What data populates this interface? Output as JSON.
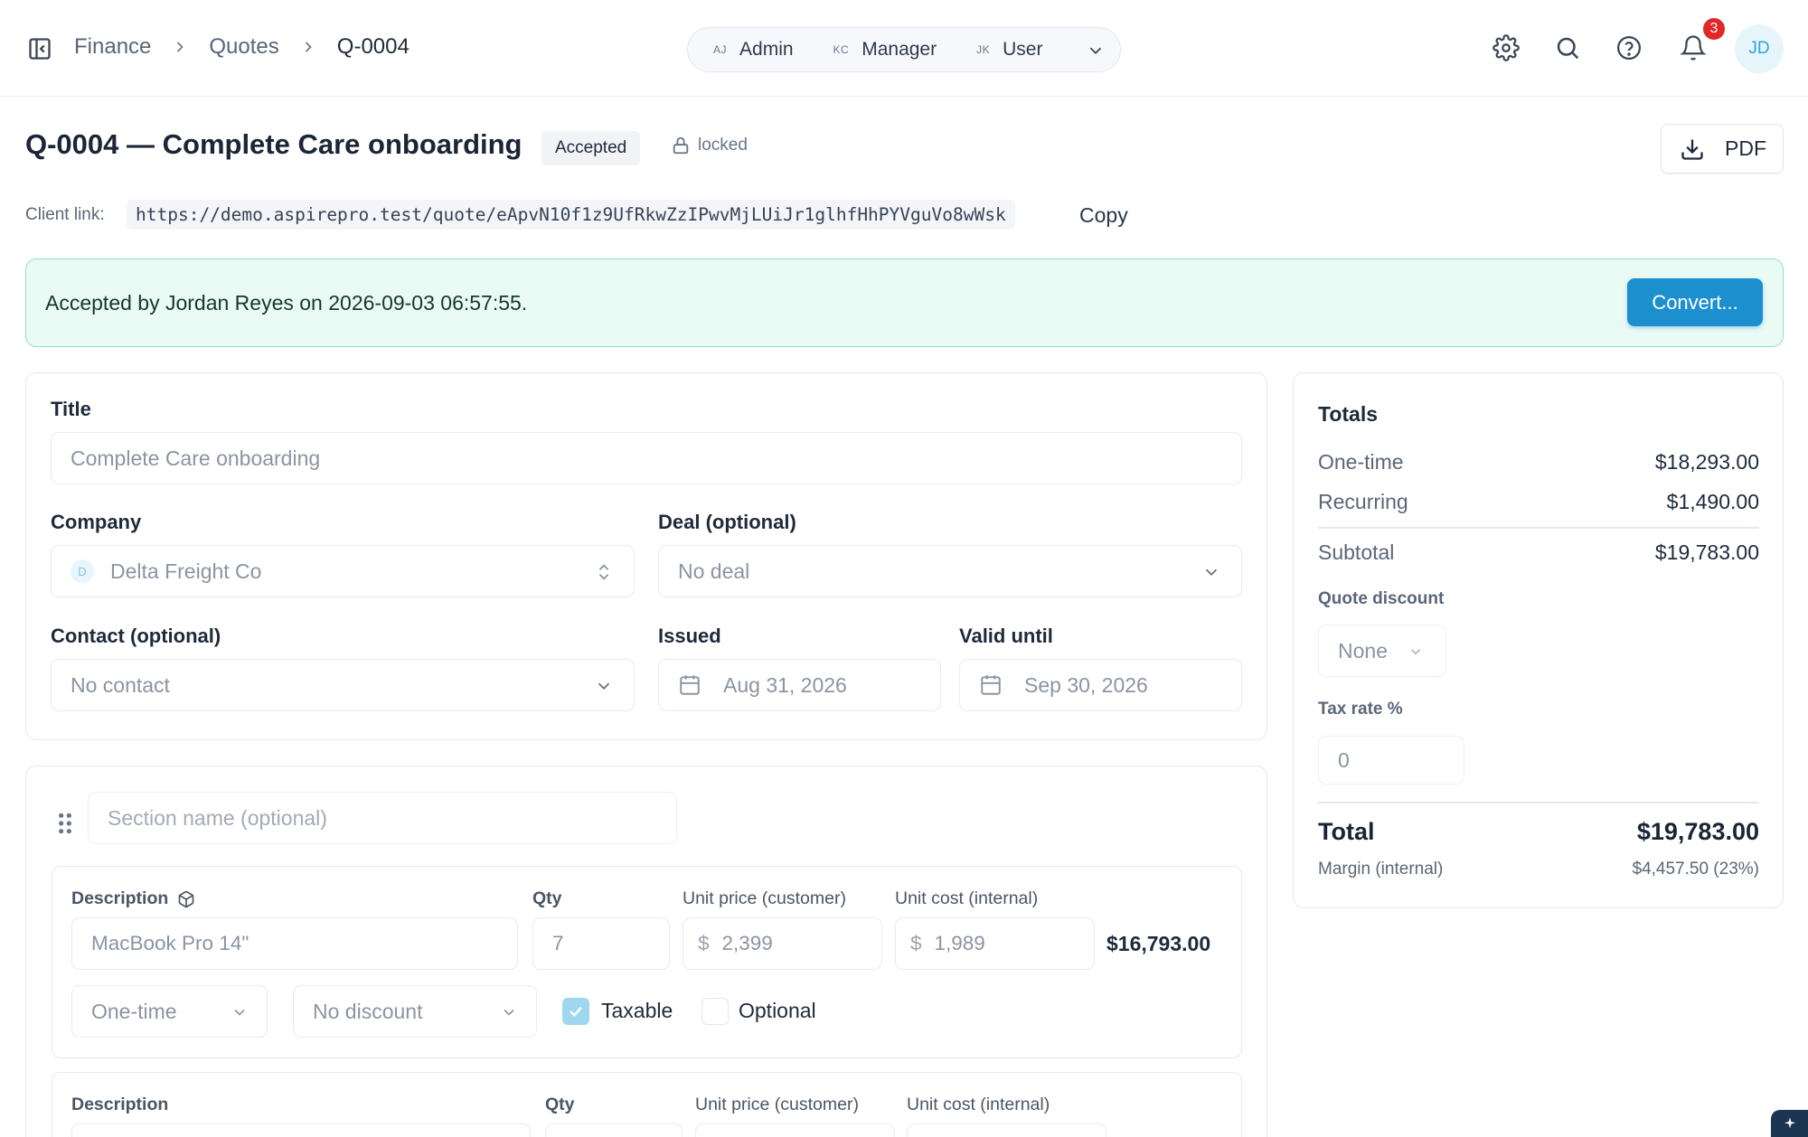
{
  "breadcrumb": {
    "items": [
      "Finance",
      "Quotes"
    ],
    "current": "Q-0004"
  },
  "role_switcher": {
    "roles": [
      {
        "abbr": "AJ",
        "label": "Admin"
      },
      {
        "abbr": "KC",
        "label": "Manager"
      },
      {
        "abbr": "JK",
        "label": "User"
      }
    ]
  },
  "topbar": {
    "notification_count": "3",
    "avatar_initials": "JD",
    "icons": [
      "sidebar-toggle-icon",
      "gear-icon",
      "search-icon",
      "help-icon",
      "bell-icon"
    ]
  },
  "header": {
    "title": "Q-0004 — Complete Care onboarding",
    "status": "Accepted",
    "locked_label": "locked",
    "pdf_label": "PDF",
    "client_link_label": "Client link:",
    "client_link_url": "https://demo.aspirepro.test/quote/eApvN10f1z9UfRkwZzIPwvMjLUiJr1glhfHhPYVguVo8wWsk",
    "copy_label": "Copy"
  },
  "banner": {
    "text": "Accepted by Jordan Reyes on 2026-09-03 06:57:55.",
    "convert_label": "Convert..."
  },
  "details": {
    "title_label": "Title",
    "title_value": "Complete Care onboarding",
    "company_label": "Company",
    "company_initial": "D",
    "company_value": "Delta Freight Co",
    "deal_label": "Deal (optional)",
    "deal_value": "No deal",
    "contact_label": "Contact (optional)",
    "contact_value": "No contact",
    "issued_label": "Issued",
    "issued_value": "Aug 31, 2026",
    "valid_label": "Valid until",
    "valid_value": "Sep 30, 2026"
  },
  "section": {
    "name_placeholder": "Section name (optional)"
  },
  "columns": {
    "description": "Description",
    "qty": "Qty",
    "unit_price": "Unit price (customer)",
    "unit_cost": "Unit cost (internal)"
  },
  "line_items": [
    {
      "description": "MacBook Pro 14\"",
      "qty": "7",
      "currency": "$",
      "unit_price": "2,399",
      "unit_cost": "1,989",
      "total": "$16,793.00",
      "billing": "One-time",
      "discount": "No discount",
      "taxable_label": "Taxable",
      "taxable": true,
      "optional_label": "Optional",
      "optional": false
    }
  ],
  "totals": {
    "title": "Totals",
    "one_time_label": "One-time",
    "one_time": "$18,293.00",
    "recurring_label": "Recurring",
    "recurring": "$1,490.00",
    "subtotal_label": "Subtotal",
    "subtotal": "$19,783.00",
    "discount_label": "Quote discount",
    "discount_value": "None",
    "tax_label": "Tax rate %",
    "tax_value": "0",
    "total_label": "Total",
    "total": "$19,783.00",
    "margin_label": "Margin (internal)",
    "margin": "$4,457.50 (23%)"
  },
  "colors": {
    "accent": "#1c8fcf",
    "banner_bg": "#eafaf4",
    "banner_border": "#8de3c3",
    "badge_red": "#e32626"
  }
}
